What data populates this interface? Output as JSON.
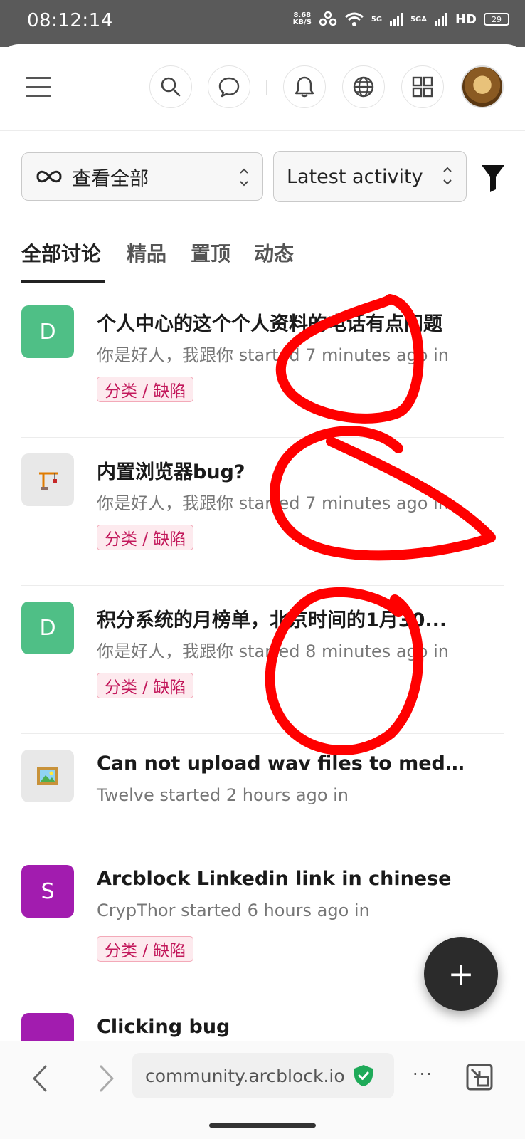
{
  "status_bar": {
    "time": "08:12:14",
    "net_speed_value": "8.68",
    "net_speed_unit": "KB/S",
    "signal1": "5G",
    "signal2": "5GA",
    "hd": "HD",
    "battery": "29"
  },
  "header": {
    "icons": [
      "menu-icon",
      "search-icon",
      "chat-icon",
      "bell-icon",
      "globe-icon",
      "apps-icon",
      "user-avatar"
    ]
  },
  "filters": {
    "category_select": "查看全部",
    "sort_select": "Latest activity"
  },
  "tabs": [
    {
      "label": "全部讨论",
      "active": true
    },
    {
      "label": "精品",
      "active": false
    },
    {
      "label": "置顶",
      "active": false
    },
    {
      "label": "动态",
      "active": false
    }
  ],
  "topics": [
    {
      "avatar_letter": "D",
      "avatar_color": "#4fbf86",
      "title": "个人中心的这个个人资料的电话有点问题",
      "meta": "你是好人，我跟你 started 7 minutes ago in",
      "tag": "分类 / 缺陷"
    },
    {
      "avatar_icon": "construction-crane-icon",
      "avatar_color": "#e8e8e8",
      "title": "内置浏览器bug?",
      "meta": "你是好人，我跟你 started 7 minutes ago in",
      "tag": "分类 / 缺陷"
    },
    {
      "avatar_letter": "D",
      "avatar_color": "#4fbf86",
      "title": "积分系统的月榜单，北京时间的1月30...",
      "meta": "你是好人，我跟你 started 8 minutes ago in",
      "tag": "分类 / 缺陷"
    },
    {
      "avatar_icon": "framed-picture-icon",
      "avatar_color": "#e8e8e8",
      "title": "Can not upload wav files to media kit",
      "meta": "Twelve started 2 hours ago in",
      "tag": ""
    },
    {
      "avatar_letter": "S",
      "avatar_color": "#a21caf",
      "title": "Arcblock Linkedin link in chinese",
      "meta": "CrypThor started 6 hours ago in",
      "tag": "分类 / 缺陷"
    },
    {
      "avatar_letter": "",
      "avatar_color": "#a21caf",
      "title": "Clicking bug",
      "meta": "",
      "tag": ""
    }
  ],
  "fab": {
    "label": "+"
  },
  "browser": {
    "url": "community.arcblock.io",
    "more": "···"
  }
}
